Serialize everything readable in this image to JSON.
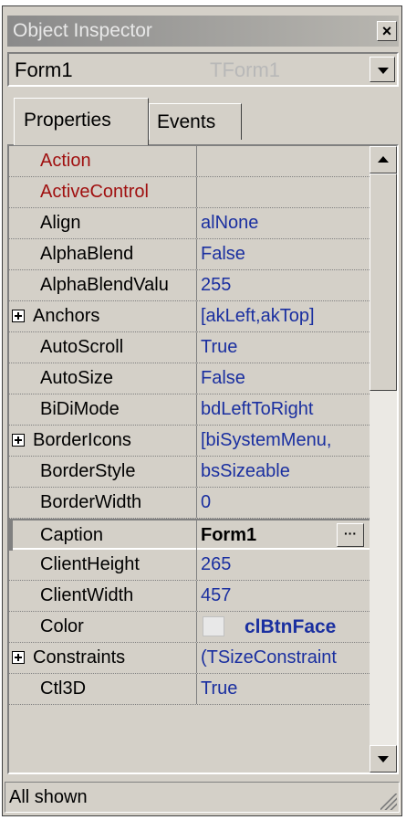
{
  "window": {
    "title": "Object Inspector",
    "close_label": "×"
  },
  "object_selector": {
    "name": "Form1",
    "type": "TForm1"
  },
  "tabs": [
    {
      "label": "Properties",
      "active": true
    },
    {
      "label": "Events",
      "active": false
    }
  ],
  "properties": [
    {
      "name": "Action",
      "value": "",
      "kind": "event"
    },
    {
      "name": "ActiveControl",
      "value": "",
      "kind": "event"
    },
    {
      "name": "Align",
      "value": "alNone"
    },
    {
      "name": "AlphaBlend",
      "value": "False"
    },
    {
      "name": "AlphaBlendValu",
      "value": "255"
    },
    {
      "name": "Anchors",
      "value": "[akLeft,akTop]",
      "expandable": true
    },
    {
      "name": "AutoScroll",
      "value": "True"
    },
    {
      "name": "AutoSize",
      "value": "False"
    },
    {
      "name": "BiDiMode",
      "value": "bdLeftToRight"
    },
    {
      "name": "BorderIcons",
      "value": "[biSystemMenu,",
      "expandable": true
    },
    {
      "name": "BorderStyle",
      "value": "bsSizeable"
    },
    {
      "name": "BorderWidth",
      "value": "0"
    },
    {
      "name": "Caption",
      "value": "Form1",
      "selected": true,
      "ellipsis": "···"
    },
    {
      "name": "ClientHeight",
      "value": "265"
    },
    {
      "name": "ClientWidth",
      "value": "457"
    },
    {
      "name": "Color",
      "value": "clBtnFace",
      "swatch": "#e8e8e8"
    },
    {
      "name": "Constraints",
      "value": "(TSizeConstraint",
      "expandable": true
    },
    {
      "name": "Ctl3D",
      "value": "True"
    }
  ],
  "status": {
    "text": "All shown"
  },
  "colors": {
    "event_name": "#a01010",
    "value_text": "#1a2fa0",
    "face": "#d4d0c8"
  },
  "icons": [
    "close-icon",
    "chevron-down-icon",
    "expand-icon",
    "scroll-up-icon",
    "scroll-down-icon",
    "size-grip-icon"
  ]
}
